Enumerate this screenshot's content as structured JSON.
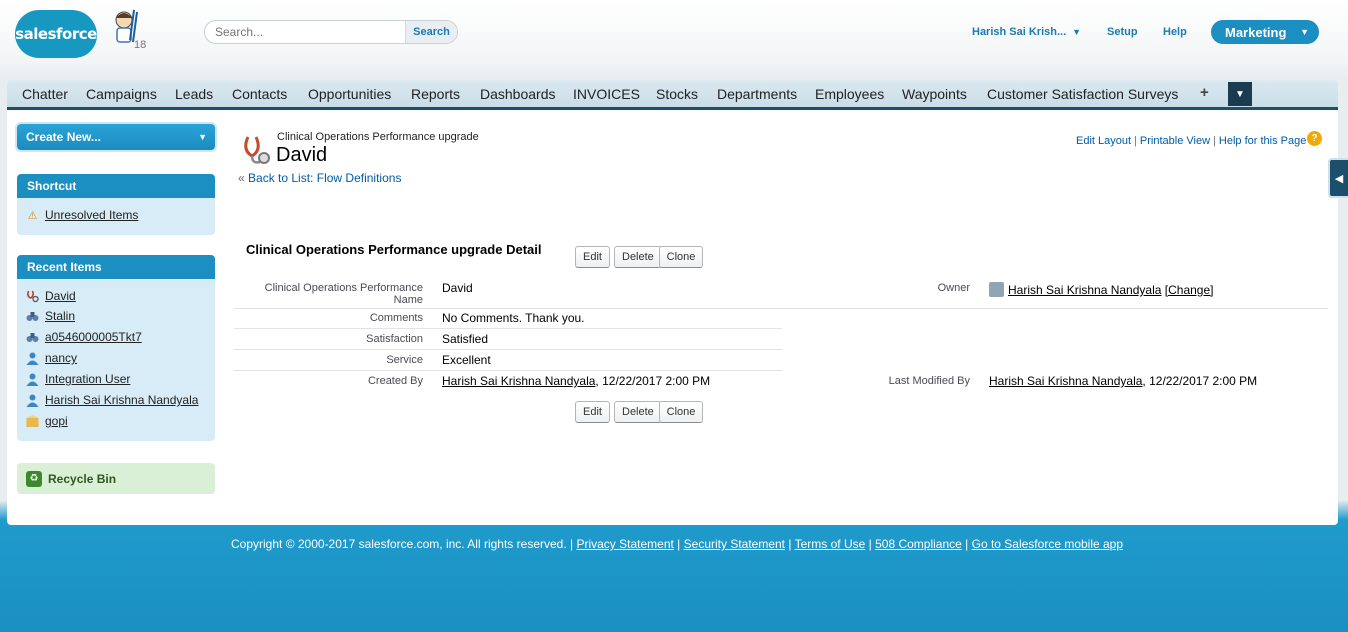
{
  "header": {
    "logo_text": "salesforce",
    "mascot_count": "18",
    "search_placeholder": "Search...",
    "search_button": "Search",
    "user_name": "Harish Sai Krish...",
    "setup": "Setup",
    "help": "Help",
    "app_name": "Marketing"
  },
  "tabs": [
    "Chatter",
    "Campaigns",
    "Leads",
    "Contacts",
    "Opportunities",
    "Reports",
    "Dashboards",
    "INVOICES",
    "Stocks",
    "Departments",
    "Employees",
    "Waypoints",
    "Customer Satisfaction Surveys"
  ],
  "tab_plus": "+",
  "sidebar": {
    "create_new": "Create New...",
    "shortcut_title": "Shortcut",
    "shortcut_items": [
      {
        "label": "Unresolved Items",
        "icon": "warning-icon"
      }
    ],
    "recent_title": "Recent Items",
    "recent_items": [
      {
        "label": "David",
        "icon": "stethoscope-icon"
      },
      {
        "label": "Stalin",
        "icon": "binoculars-icon"
      },
      {
        "label": "a0546000005Tkt7",
        "icon": "binoculars-icon"
      },
      {
        "label": "nancy",
        "icon": "user-icon"
      },
      {
        "label": "Integration User",
        "icon": "user-icon"
      },
      {
        "label": "Harish Sai Krishna Nandyala",
        "icon": "user-icon"
      },
      {
        "label": "gopi",
        "icon": "box-icon"
      }
    ],
    "recycle_bin": "Recycle Bin"
  },
  "record": {
    "type_label": "Clinical Operations Performance upgrade",
    "title": "David",
    "back_prefix": "«",
    "back_link": "Back to List:",
    "back_target": "Flow Definitions",
    "edit_layout": "Edit Layout",
    "printable_view": "Printable View",
    "help_page": "Help for this Page",
    "separator": "|",
    "detail_title": "Clinical Operations Performance upgrade Detail",
    "buttons": {
      "edit": "Edit",
      "delete": "Delete",
      "clone": "Clone"
    },
    "fields": {
      "name_label": "Clinical Operations Performance Name",
      "name_value": "David",
      "owner_label": "Owner",
      "owner_value": "Harish Sai Krishna Nandyala",
      "owner_change": "[Change]",
      "comments_label": "Comments",
      "comments_value": "No Comments. Thank you.",
      "satisfaction_label": "Satisfaction",
      "satisfaction_value": "Satisfied",
      "service_label": "Service",
      "service_value": "Excellent",
      "created_by_label": "Created By",
      "created_by_user": "Harish Sai Krishna Nandyala",
      "created_by_date": ", 12/22/2017 2:00 PM",
      "modified_by_label": "Last Modified By",
      "modified_by_user": "Harish Sai Krishna Nandyala",
      "modified_by_date": ", 12/22/2017 2:00 PM"
    }
  },
  "footer": {
    "copyright": "Copyright © 2000-2017 salesforce.com, inc. All rights reserved. |",
    "links": [
      "Privacy Statement",
      "Security Statement",
      "Terms of Use",
      "508 Compliance",
      "Go to Salesforce mobile app"
    ]
  }
}
